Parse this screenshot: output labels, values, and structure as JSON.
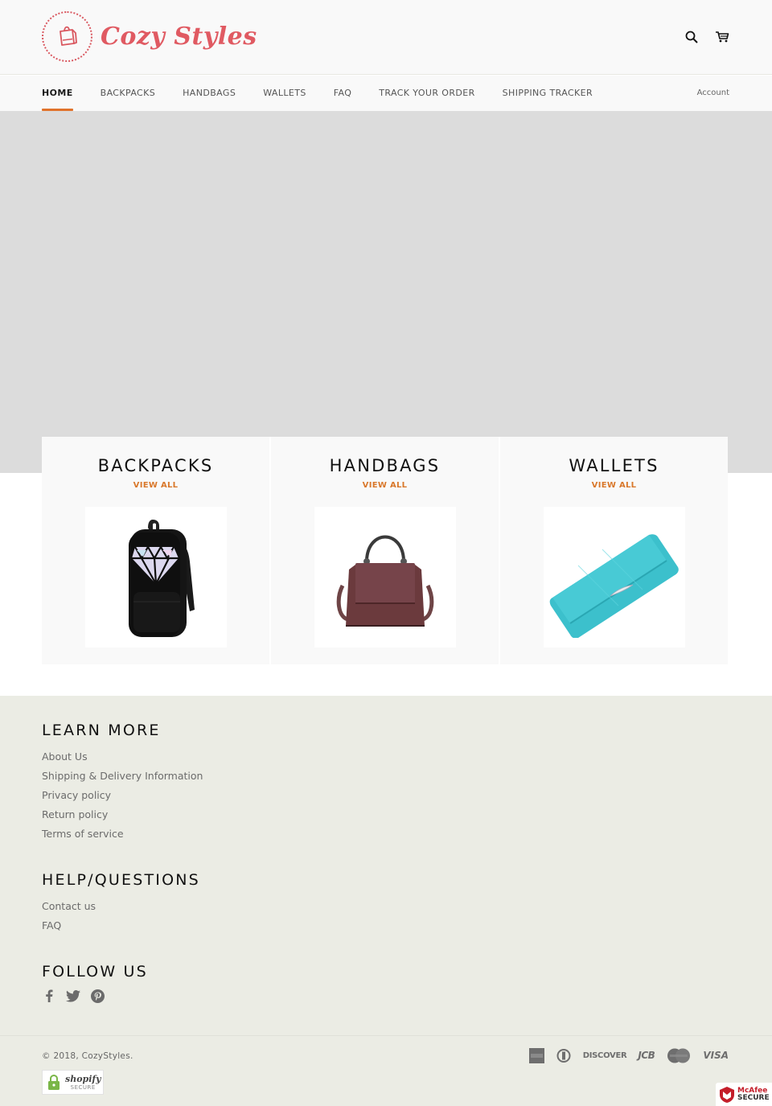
{
  "header": {
    "logo_text": "Cozy Styles",
    "icons": [
      "shopping-bag-icon",
      "search-icon",
      "cart-icon"
    ],
    "accent_color": "#e05a62"
  },
  "nav": {
    "items": [
      {
        "label": "HOME",
        "active": true
      },
      {
        "label": "BACKPACKS",
        "active": false
      },
      {
        "label": "HANDBAGS",
        "active": false
      },
      {
        "label": "WALLETS",
        "active": false
      },
      {
        "label": "FAQ",
        "active": false
      },
      {
        "label": "TRACK YOUR ORDER",
        "active": false
      },
      {
        "label": "SHIPPING TRACKER",
        "active": false
      }
    ],
    "account_label": "Account",
    "active_color": "#e0732c"
  },
  "collections": [
    {
      "title": "BACKPACKS",
      "link_label": "VIEW ALL",
      "image": "black backpack with holographic diamond"
    },
    {
      "title": "HANDBAGS",
      "link_label": "VIEW ALL",
      "image": "burgundy leather handbag"
    },
    {
      "title": "WALLETS",
      "link_label": "VIEW ALL",
      "image": "turquoise long wallet"
    }
  ],
  "footer": {
    "learn_more": {
      "heading": "LEARN MORE",
      "links": [
        "About Us",
        "Shipping & Delivery Information",
        "Privacy policy",
        "Return policy",
        "Terms of service"
      ]
    },
    "help": {
      "heading": "HELP/QUESTIONS",
      "links": [
        "Contact us",
        "FAQ"
      ]
    },
    "follow": {
      "heading": "FOLLOW US",
      "icons": [
        "facebook-icon",
        "twitter-icon",
        "pinterest-icon"
      ]
    },
    "copyright": "© 2018, CozyStyles.",
    "shopify_badge": {
      "brand": "shopify",
      "label": "SECURE"
    },
    "payments": [
      "american-express",
      "diners-club",
      "DISCOVER",
      "JCB",
      "mastercard",
      "VISA"
    ],
    "mcafee": {
      "brand": "McAfee",
      "label": "SECURE"
    }
  }
}
